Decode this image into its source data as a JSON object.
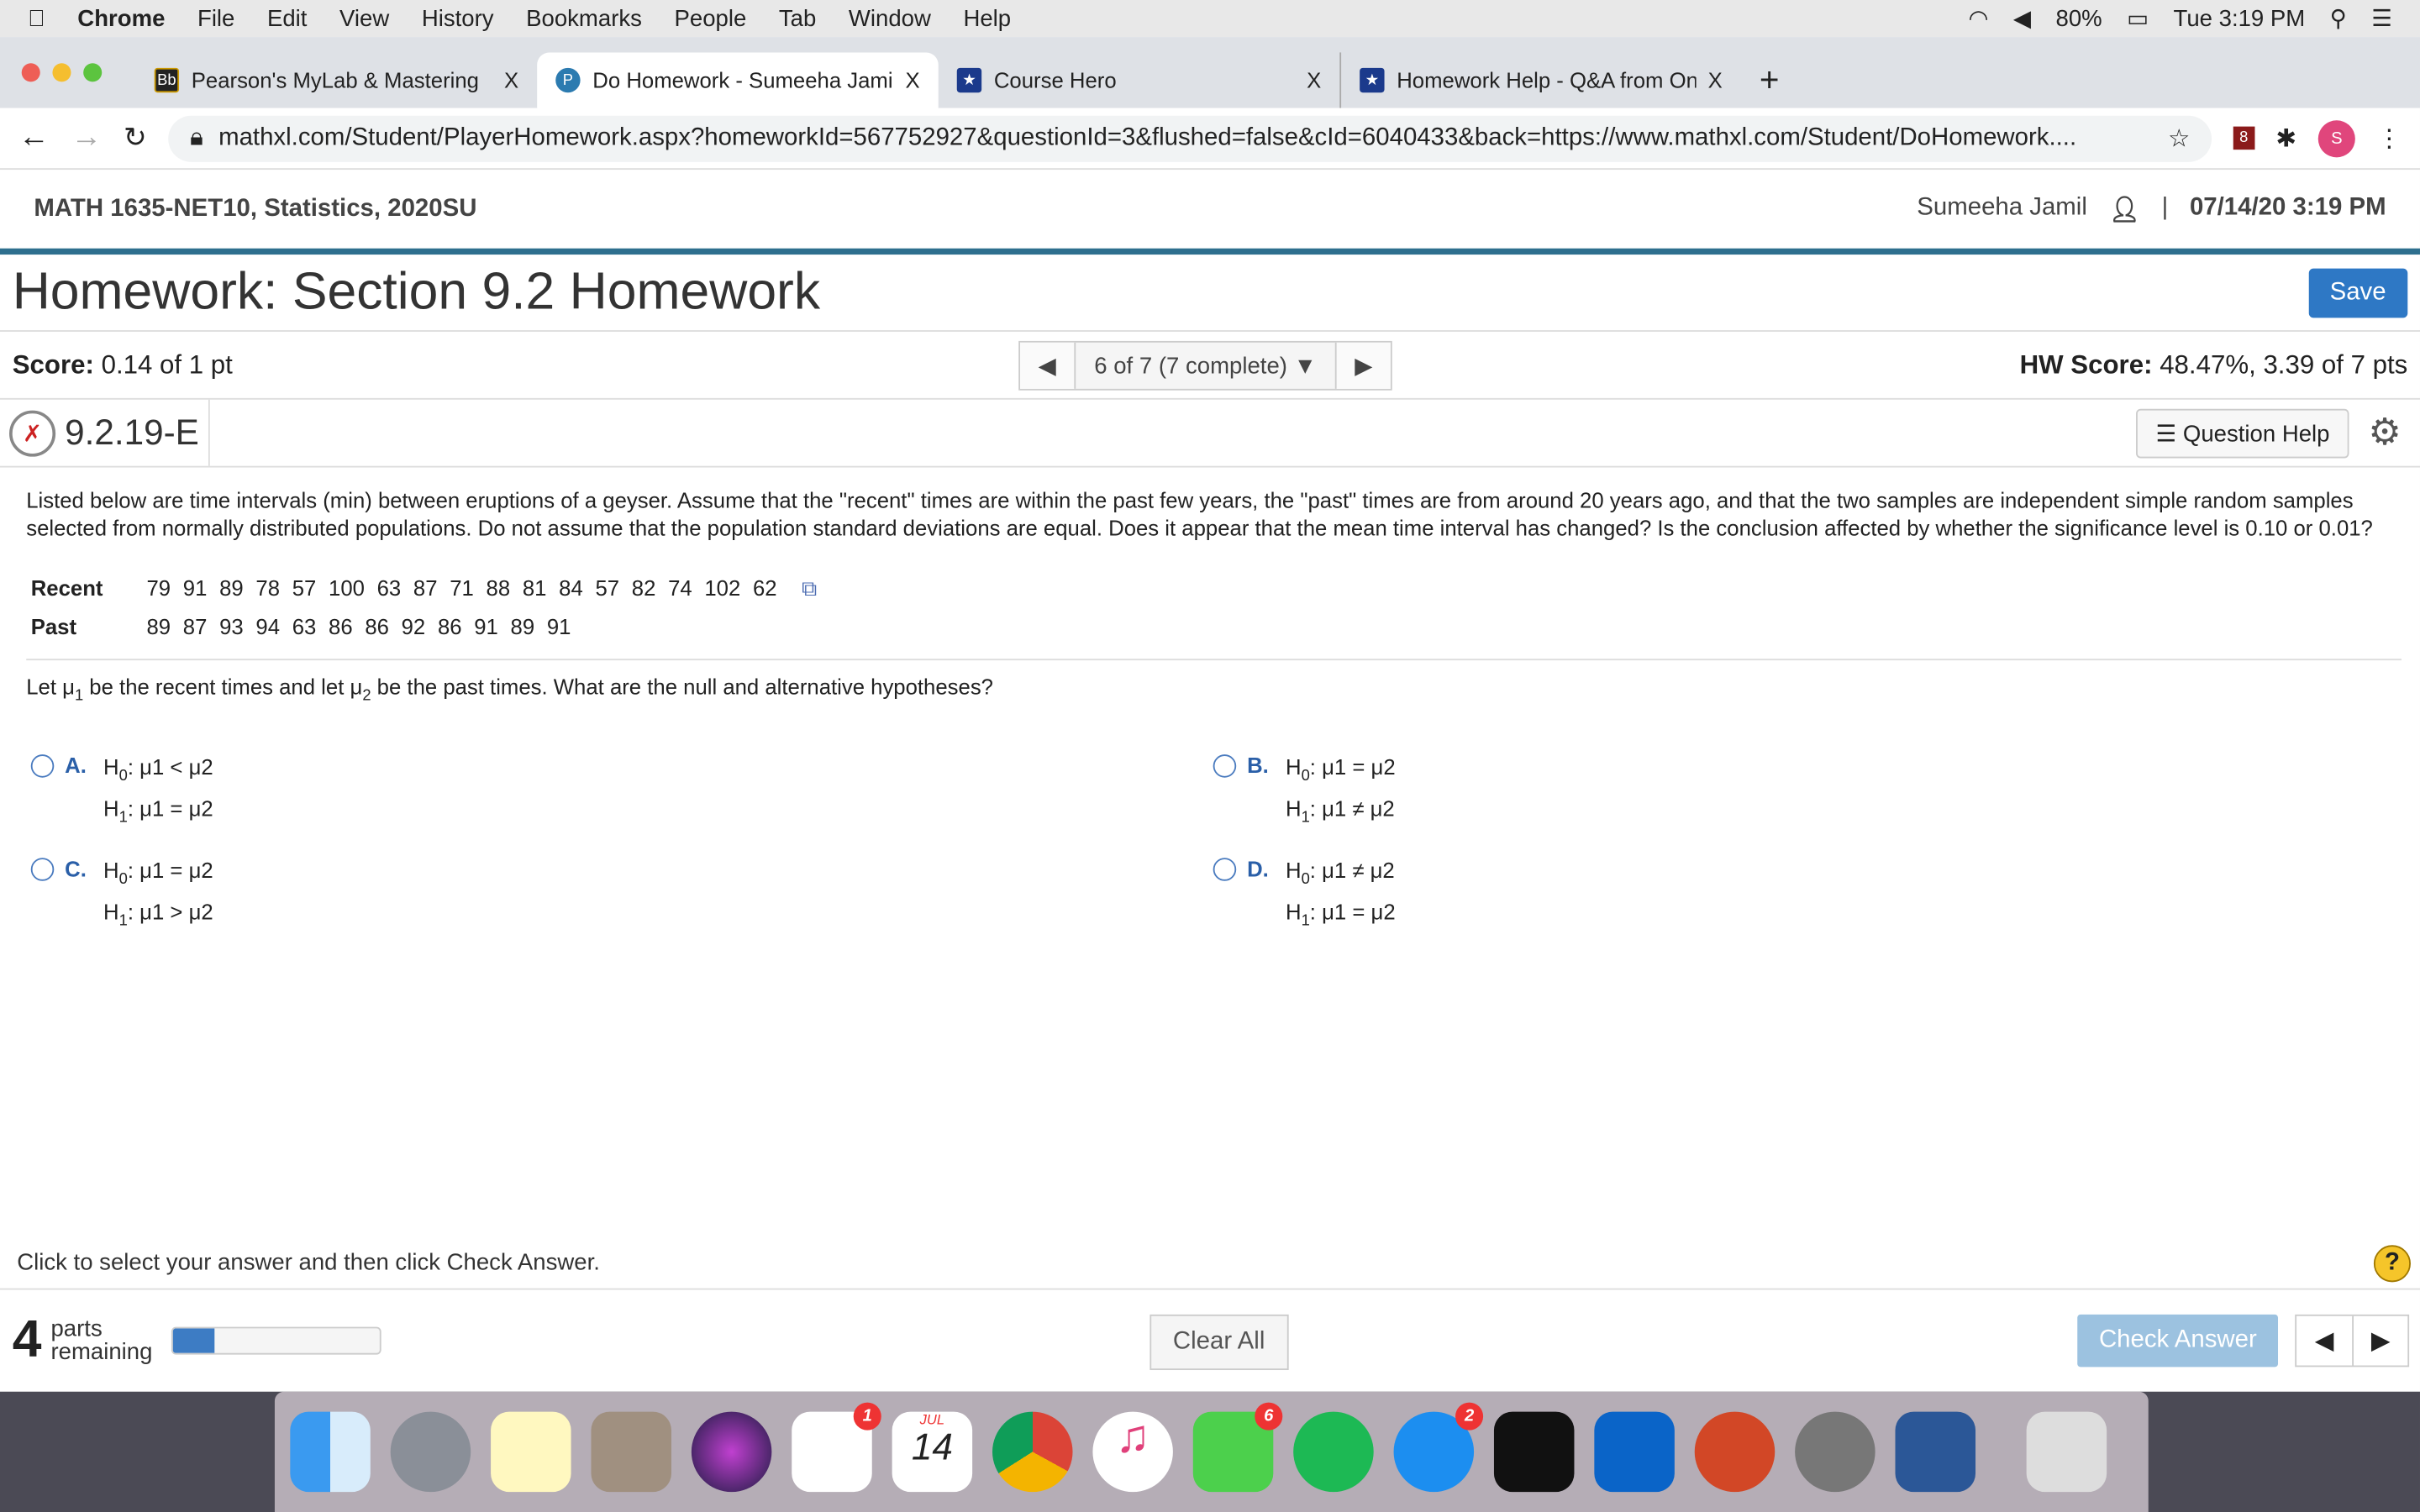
{
  "menubar": {
    "app": "Chrome",
    "items": [
      "File",
      "Edit",
      "View",
      "History",
      "Bookmarks",
      "People",
      "Tab",
      "Window",
      "Help"
    ],
    "battery": "80%",
    "clock": "Tue 3:19 PM"
  },
  "tabs": [
    {
      "title": "Pearson's MyLab & Mastering",
      "icon": "Bb",
      "close": "X"
    },
    {
      "title": "Do Homework - Sumeeha Jamil",
      "icon": "P",
      "close": "X"
    },
    {
      "title": "Course Hero",
      "icon": "★",
      "close": "X"
    },
    {
      "title": "Homework Help - Q&A from Online",
      "icon": "★",
      "close": "X"
    }
  ],
  "new_tab": "+",
  "address": {
    "url": "mathxl.com/Student/PlayerHomework.aspx?homeworkId=567752927&questionId=3&flushed=false&cId=6040433&back=https://www.mathxl.com/Student/DoHomework....",
    "ext_badge": "8",
    "profile": "S"
  },
  "course": {
    "name": "MATH 1635-NET10, Statistics, 2020SU",
    "user": "Sumeeha Jamil",
    "sep": "|",
    "datetime": "07/14/20 3:19 PM"
  },
  "homework": {
    "title": "Homework: Section 9.2 Homework",
    "save": "Save"
  },
  "score": {
    "label": "Score:",
    "value": "0.14 of 1 pt",
    "nav": "6 of 7 (7 complete)",
    "hw_label": "HW Score:",
    "hw_value": "48.47%, 3.39 of 7 pts"
  },
  "question": {
    "id": "9.2.19-E",
    "help": "Question Help",
    "text": "Listed below are time intervals (min) between eruptions of a geyser. Assume that the \"recent\" times are within the past few years, the \"past\" times are from around 20 years ago, and that the two samples are independent simple random samples selected from normally distributed populations. Do not assume that the population standard deviations are equal. Does it appear that the mean time interval has changed? Is the conclusion affected by whether the significance level is 0.10 or 0.01?",
    "recent_label": "Recent",
    "recent": [
      "79",
      "91",
      "89",
      "78",
      "57",
      "100",
      "63",
      "87",
      "71",
      "88",
      "81",
      "84",
      "57",
      "82",
      "74",
      "102",
      "62"
    ],
    "past_label": "Past",
    "past": [
      "89",
      "87",
      "93",
      "94",
      "63",
      "86",
      "86",
      "92",
      "86",
      "91",
      "89",
      "91"
    ],
    "prompt": {
      "a": "Let μ",
      "s1": "1",
      "b": " be the recent times and let μ",
      "s2": "2",
      "c": " be the past times. What are the null and alternative hypotheses?"
    },
    "options": [
      {
        "letter": "A.",
        "h0": "μ1 < μ2",
        "h1": "μ1 = μ2"
      },
      {
        "letter": "B.",
        "h0": "μ1 = μ2",
        "h1": "μ1 ≠ μ2"
      },
      {
        "letter": "C.",
        "h0": "μ1 = μ2",
        "h1": "μ1 > μ2"
      },
      {
        "letter": "D.",
        "h0": "μ1 ≠ μ2",
        "h1": "μ1 = μ2"
      }
    ]
  },
  "footer": {
    "hint": "Click to select your answer and then click Check Answer.",
    "help": "?",
    "parts_num": "4",
    "parts_text1": "parts",
    "parts_text2": "remaining",
    "progress_percent": 20,
    "clear": "Clear All",
    "check": "Check Answer"
  },
  "dock_badges": {
    "reminders": "1",
    "calendar_month": "JUL",
    "calendar_day": "14",
    "facetime": "6",
    "appstore": "2"
  }
}
